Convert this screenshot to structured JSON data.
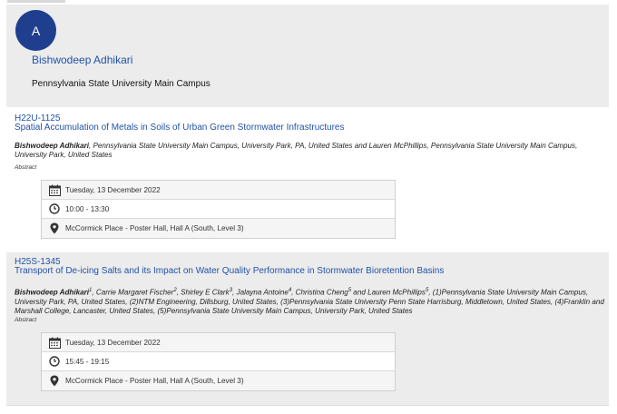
{
  "profile": {
    "avatar_letter": "A",
    "name": "Bishwodeep Adhikari",
    "institution": "Pennsylvania State University Main Campus"
  },
  "abstracts": [
    {
      "code": "H22U-1125",
      "title": "Spatial Accumulation of Metals in Soils of Urban Green Stormwater Infrastructures",
      "author_lead": "Bishwodeep Adhikari",
      "authors_rest": ", Pennsylvania State University Main Campus, University Park, PA, United States and Lauren McPhillips, Pennsylvania State University Main Campus, University Park, United States",
      "abstract_label": "Abstract",
      "date": "Tuesday, 13 December 2022",
      "time": "10:00 - 13:30",
      "location": "McCormick Place - Poster Hall, Hall A (South, Level 3)"
    },
    {
      "code": "H25S-1345",
      "title": "Transport of De-icing Salts and its Impact on Water Quality Performance in Stormwater Bioretention Basins",
      "author_lead": "Bishwodeep Adhikari",
      "authors_parts": [
        {
          "t": "1"
        },
        {
          "n": ", Carrie Margaret Fischer"
        },
        {
          "t": "2"
        },
        {
          "n": ", Shirley E Clark"
        },
        {
          "t": "3"
        },
        {
          "n": ", Jalayna Antoine"
        },
        {
          "t": "4"
        },
        {
          "n": ", Christina Cheng"
        },
        {
          "t": "5"
        },
        {
          "n": " and Lauren McPhillips"
        },
        {
          "t": "5"
        },
        {
          "n": ", (1)Pennsylvania State University Main Campus, University Park, PA, United States, (2)NTM Engineering, Dillsburg, United States, (3)Pennsylvania State University Penn State Harrisburg, Middletown, United States, (4)Franklin and Marshall College, Lancaster, United States, (5)Pennsylvania State University Main Campus, University Park, United States"
        }
      ],
      "abstract_label": "Abstract",
      "date": "Tuesday, 13 December 2022",
      "time": "15:45 - 19:15",
      "location": "McCormick Place - Poster Hall, Hall A (South, Level 3)"
    }
  ],
  "icons": {
    "date": "calendar-icon",
    "time": "clock-icon",
    "location": "map-pin-icon"
  },
  "colors": {
    "link": "#2251a8",
    "avatar": "#1f3f8e",
    "panel": "#ececec"
  }
}
